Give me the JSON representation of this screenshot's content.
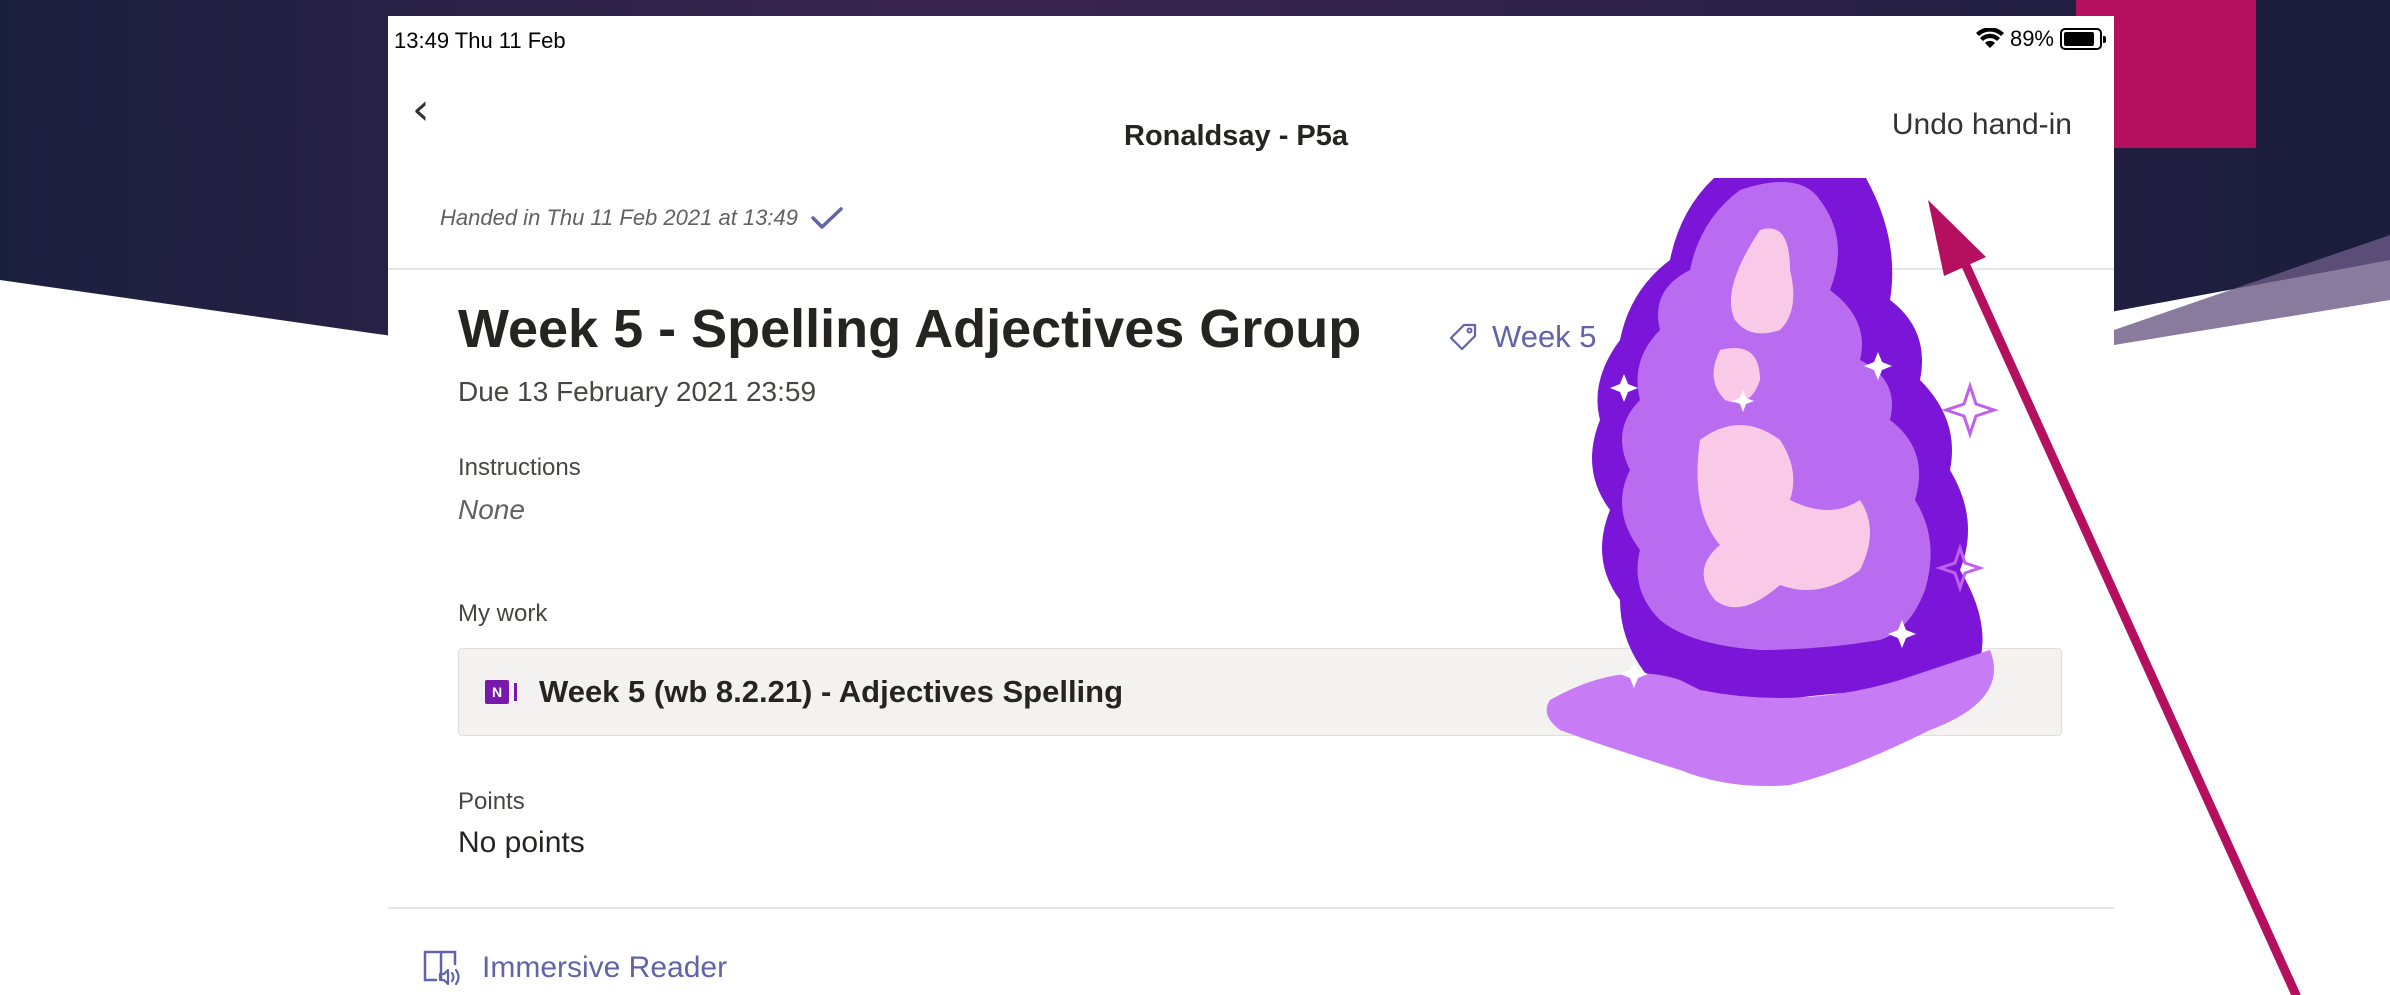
{
  "status_bar": {
    "time": "13:49  Thu 11 Feb",
    "battery": "89%"
  },
  "nav": {
    "back_icon": "chevron-left-icon",
    "title": "Ronaldsay - P5a",
    "undo_label": "Undo hand-in"
  },
  "handed_in": {
    "text": "Handed in Thu 11 Feb 2021 at 13:49",
    "icon": "checkmark-icon"
  },
  "assignment": {
    "title": "Week 5 - Spelling Adjectives Group",
    "tag_icon": "tag-icon",
    "tag": "Week 5",
    "due": "Due 13 February 2021 23:59"
  },
  "instructions": {
    "label": "Instructions",
    "value": "None"
  },
  "my_work": {
    "label": "My work",
    "file_icon": "onenote-icon",
    "file_name": "Week 5 (wb 8.2.21) - Adjectives Spelling"
  },
  "points": {
    "label": "Points",
    "value": "No points"
  },
  "immersive_reader": {
    "icon": "immersive-reader-icon",
    "label": "Immersive Reader"
  },
  "colors": {
    "accent": "#6264a7",
    "arrow": "#b5105f",
    "slide_dark": "#2b1f45",
    "slide_pink": "#b5105f",
    "sticker_purple": "#b96cf0",
    "sticker_pink": "#f9c9e8"
  }
}
